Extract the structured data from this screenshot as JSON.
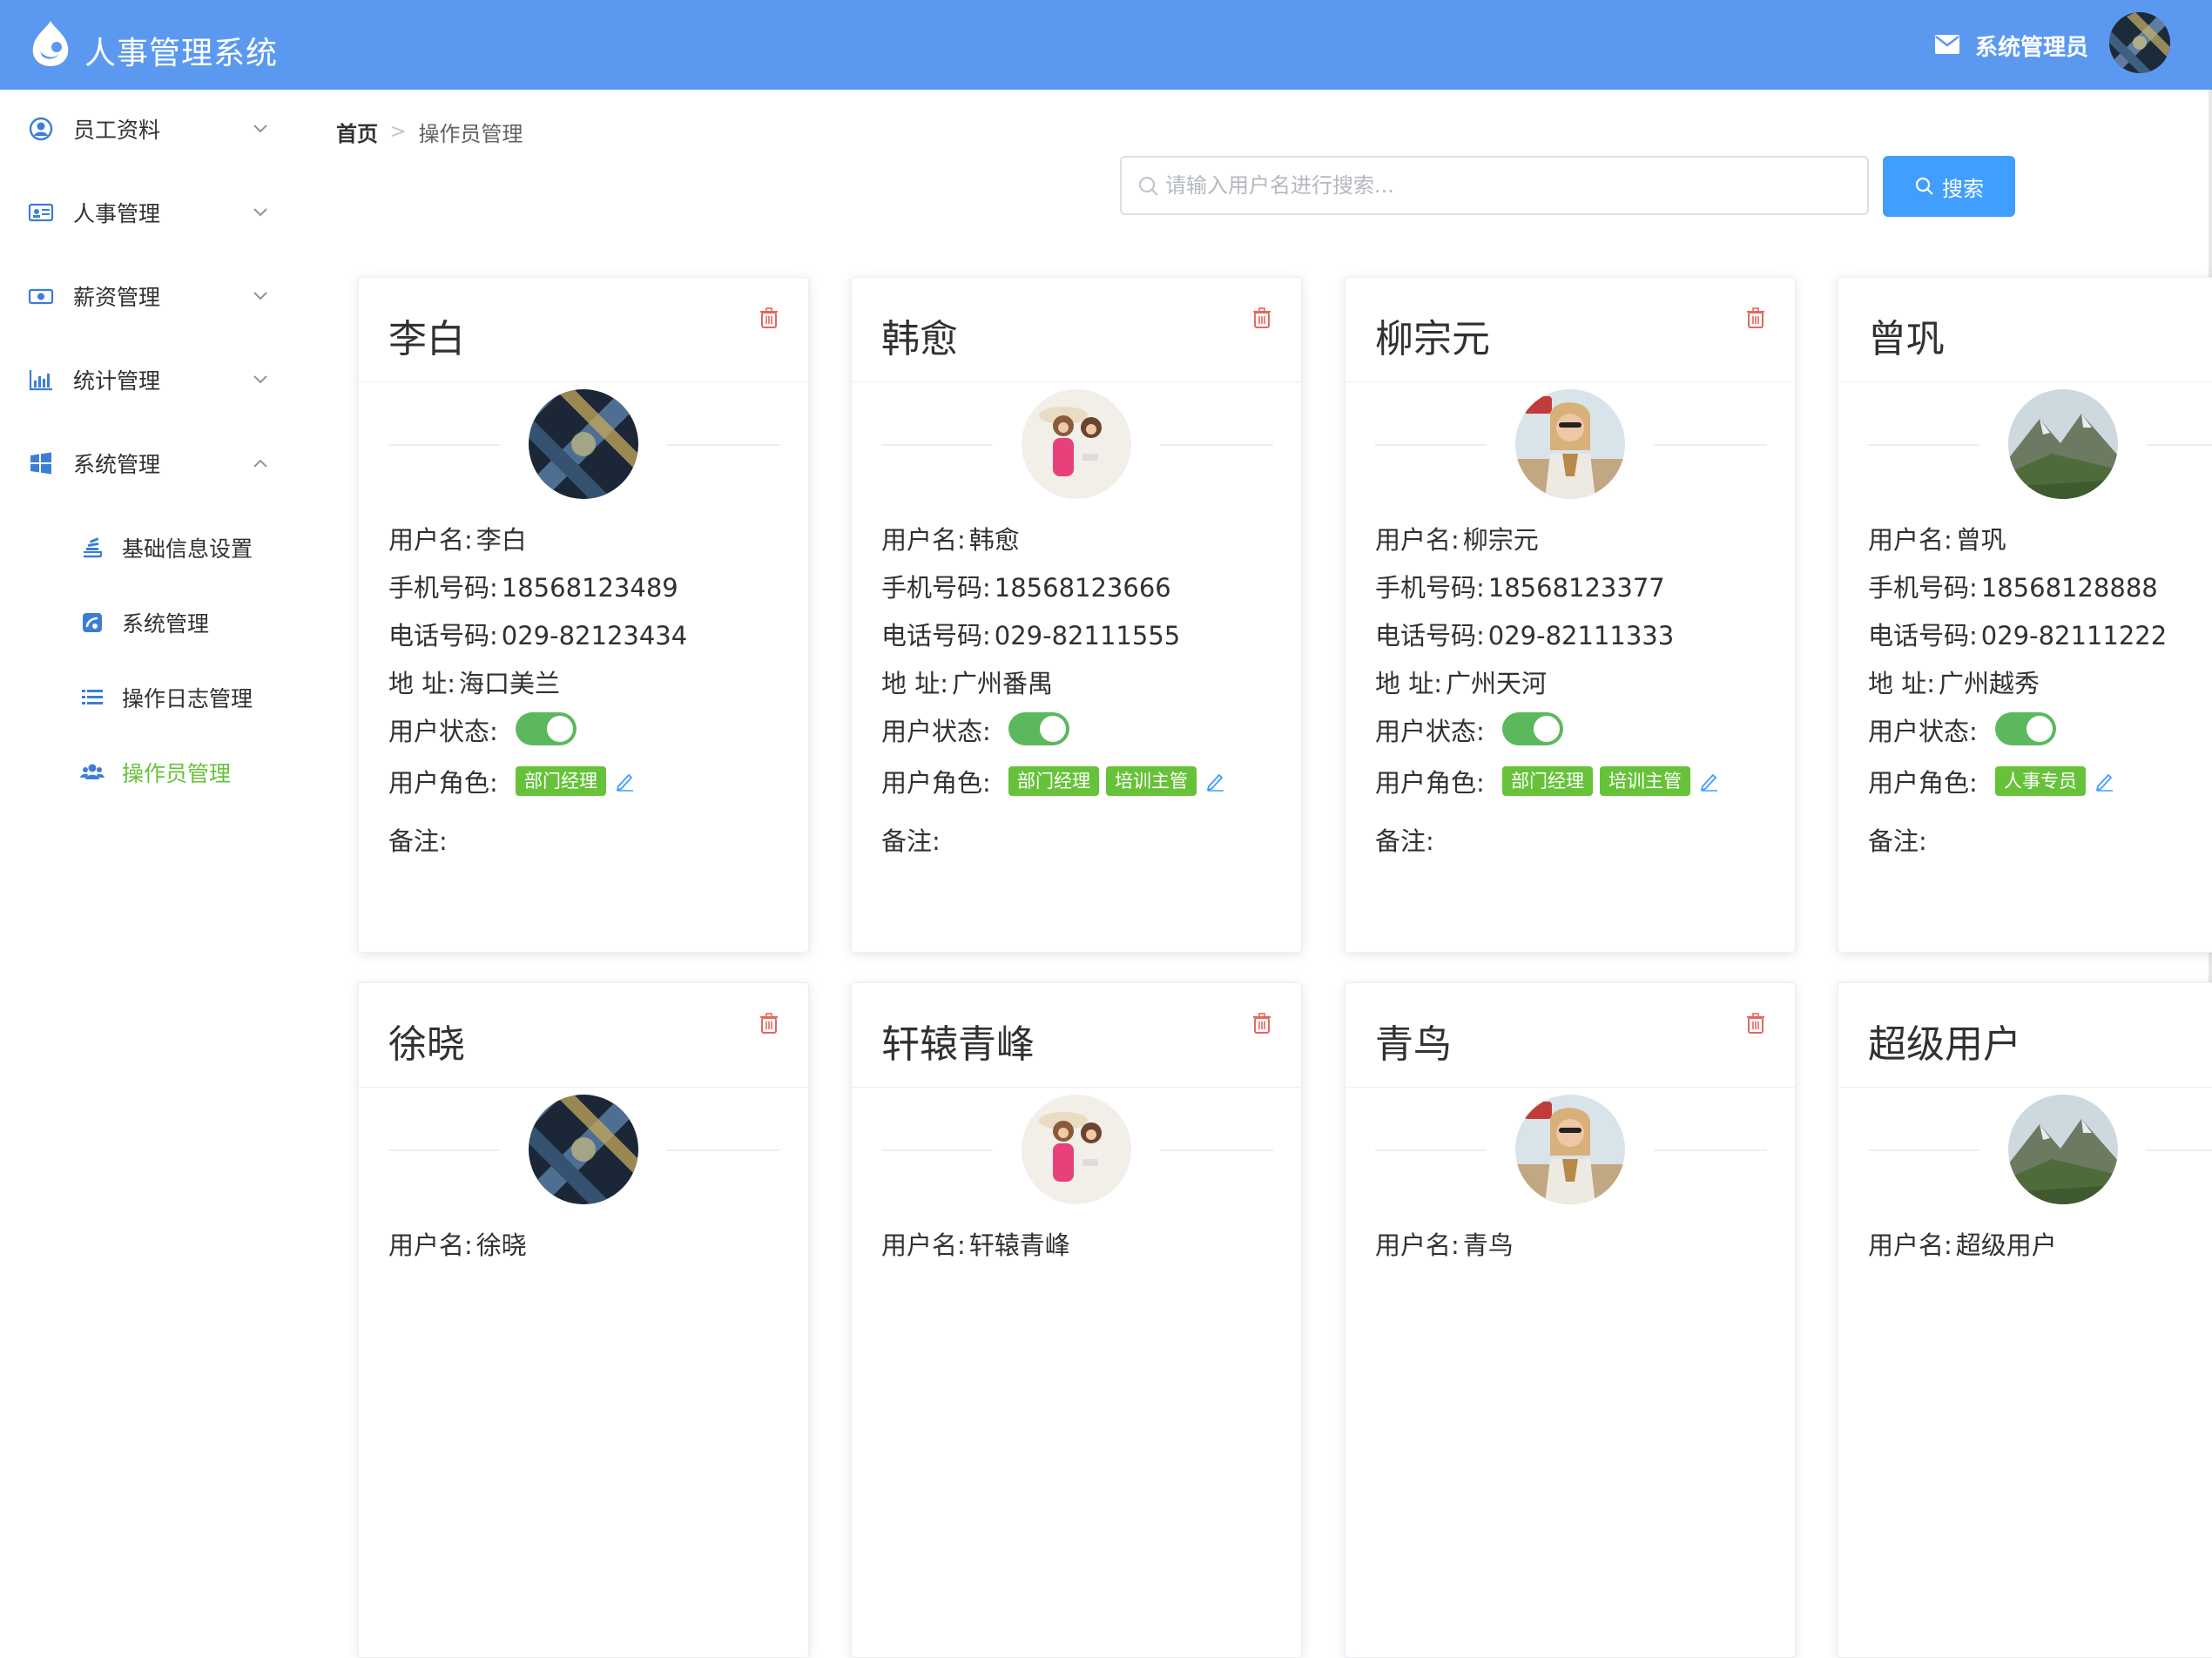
{
  "header": {
    "title": "人事管理系统",
    "admin_name": "系统管理员",
    "brand_color": "#5b99f0"
  },
  "sidebar": {
    "menus": [
      {
        "label": "员工资料",
        "icon": "user-circle-icon",
        "expanded": false
      },
      {
        "label": "人事管理",
        "icon": "id-card-icon",
        "expanded": false
      },
      {
        "label": "薪资管理",
        "icon": "money-icon",
        "expanded": false
      },
      {
        "label": "统计管理",
        "icon": "bar-chart-icon",
        "expanded": false
      },
      {
        "label": "系统管理",
        "icon": "windows-icon",
        "expanded": true
      }
    ],
    "sub_items": [
      {
        "label": "基础信息设置",
        "icon": "stack-icon",
        "active": false
      },
      {
        "label": "系统管理",
        "icon": "system-icon",
        "active": false
      },
      {
        "label": "操作日志管理",
        "icon": "list-icon",
        "active": false
      },
      {
        "label": "操作员管理",
        "icon": "users-icon",
        "active": true
      }
    ],
    "active_color": "#67c23a"
  },
  "breadcrumb": {
    "home": "首页",
    "current": "操作员管理"
  },
  "search": {
    "placeholder": "请输入用户名进行搜索...",
    "value": "",
    "button_label": "搜索"
  },
  "labels": {
    "username": "用户名:",
    "mobile": "手机号码:",
    "phone": "电话号码:",
    "address": "地 址:",
    "status": "用户状态:",
    "roles": "用户角色:",
    "remark": "备注:"
  },
  "cards": [
    {
      "name": "李白",
      "username": "李白",
      "mobile": "18568123489",
      "phone": "029-82123434",
      "address": "海口美兰",
      "enabled": true,
      "roles": [
        "部门经理"
      ],
      "remark": "",
      "avatar": "city-night"
    },
    {
      "name": "韩愈",
      "username": "韩愈",
      "mobile": "18568123666",
      "phone": "029-82111555",
      "address": "广州番禺",
      "enabled": true,
      "roles": [
        "部门经理",
        "培训主管"
      ],
      "remark": "",
      "avatar": "girls"
    },
    {
      "name": "柳宗元",
      "username": "柳宗元",
      "mobile": "18568123377",
      "phone": "029-82111333",
      "address": "广州天河",
      "enabled": true,
      "roles": [
        "部门经理",
        "培训主管"
      ],
      "remark": "",
      "avatar": "woman-car"
    },
    {
      "name": "曾巩",
      "username": "曾巩",
      "mobile": "18568128888",
      "phone": "029-82111222",
      "address": "广州越秀",
      "enabled": true,
      "roles": [
        "人事专员"
      ],
      "remark": "",
      "avatar": "mountain"
    },
    {
      "name": "徐晓",
      "username": "徐晓",
      "avatar": "city-night"
    },
    {
      "name": "轩辕青峰",
      "username": "轩辕青峰",
      "avatar": "girls"
    },
    {
      "name": "青鸟",
      "username": "青鸟",
      "avatar": "woman-car"
    },
    {
      "name": "超级用户",
      "username": "超级用户",
      "avatar": "mountain"
    }
  ],
  "colors": {
    "toggle_on": "#5cb85c",
    "role_tag": "#67c23a",
    "delete": "#e6665e",
    "search_button": "#409eff"
  }
}
